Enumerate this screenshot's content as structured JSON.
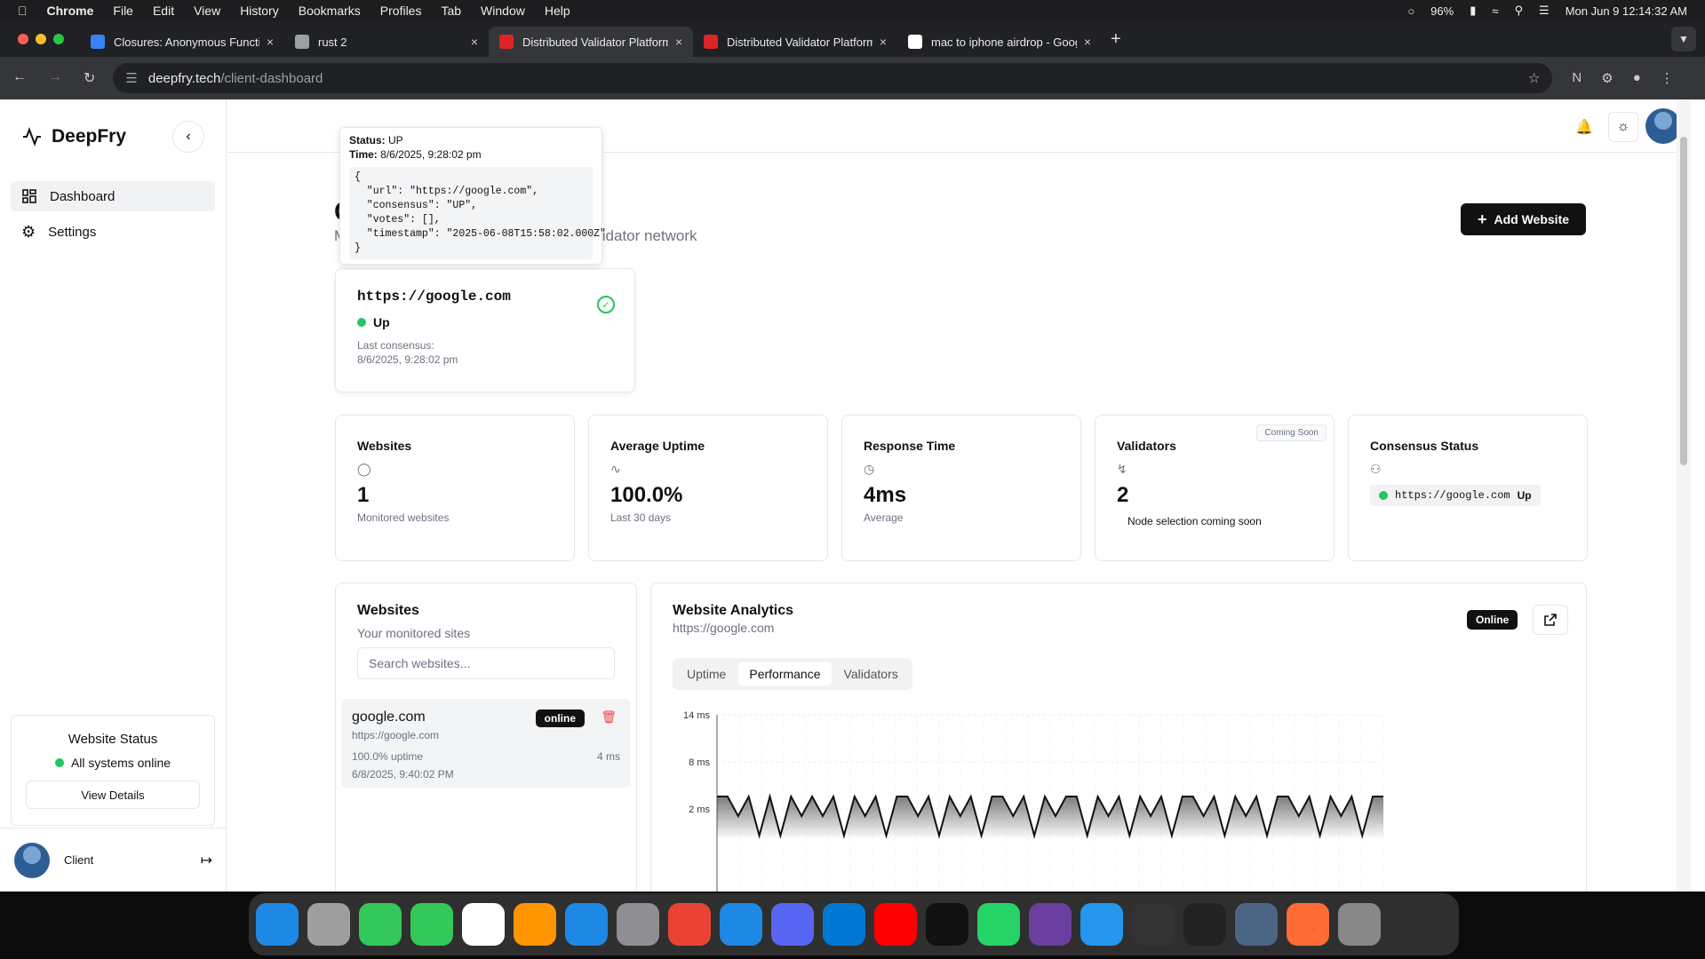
{
  "menubar": {
    "app": "Chrome",
    "items": [
      "File",
      "Edit",
      "View",
      "History",
      "Bookmarks",
      "Profiles",
      "Tab",
      "Window",
      "Help"
    ],
    "battery": "96%",
    "datetime": "Mon Jun 9  12:14:32 AM"
  },
  "tabs": [
    {
      "title": "Closures: Anonymous Functio",
      "favicon_color": "#3b82f6",
      "active": false
    },
    {
      "title": "rust 2",
      "favicon_color": "#9aa0a6",
      "active": false
    },
    {
      "title": "Distributed Validator Platform",
      "favicon_color": "#dc2626",
      "active": true
    },
    {
      "title": "Distributed Validator Platform",
      "favicon_color": "#dc2626",
      "active": false
    },
    {
      "title": "mac to iphone airdrop - Goog",
      "favicon_color": "#ffffff",
      "active": false
    }
  ],
  "address": {
    "host": "deepfry.tech",
    "path": "/client-dashboard"
  },
  "sidebar": {
    "brand": "DeepFry",
    "nav": [
      {
        "label": "Dashboard",
        "active": true
      },
      {
        "label": "Settings",
        "active": false
      }
    ],
    "status_title": "Website Status",
    "status_text": "All systems online",
    "status_button": "View Details",
    "user": "Client"
  },
  "header": {
    "title_fragment": "C",
    "subtitle_fragment_left": "M",
    "subtitle_fragment_right": "lidator network",
    "add_button": "Add Website"
  },
  "tooltip": {
    "status_label": "Status:",
    "status_value": "UP",
    "time_label": "Time:",
    "time_value": "8/6/2025, 9:28:02 pm",
    "json": "{\n  \"url\": \"https://google.com\",\n  \"consensus\": \"UP\",\n  \"votes\": [],\n  \"timestamp\": \"2025-06-08T15:58:02.000Z\"\n}"
  },
  "site_card": {
    "url": "https://google.com",
    "status": "Up",
    "last_label": "Last consensus:",
    "last_value": "8/6/2025, 9:28:02 pm"
  },
  "stats": [
    {
      "label": "Websites",
      "icon": "globe-icon",
      "value": "1",
      "caption": "Monitored websites"
    },
    {
      "label": "Average Uptime",
      "icon": "activity-icon",
      "value": "100.0%",
      "caption": "Last 30 days"
    },
    {
      "label": "Response Time",
      "icon": "clock-icon",
      "value": "4ms",
      "caption": "Average"
    },
    {
      "label": "Validators",
      "icon": "zap-icon",
      "value": "2",
      "caption": "Node selection coming soon",
      "badge": "Coming Soon"
    },
    {
      "label": "Consensus Status",
      "icon": "users-icon",
      "chip_url": "https://google.com",
      "chip_status": "Up"
    }
  ],
  "websites_panel": {
    "title": "Websites",
    "subtitle": "Your monitored sites",
    "search_placeholder": "Search websites...",
    "items": [
      {
        "name": "google.com",
        "url": "https://google.com",
        "status": "online",
        "uptime": "100.0% uptime",
        "response": "4 ms",
        "date": "6/8/2025, 9:40:02 PM"
      }
    ]
  },
  "analytics": {
    "title": "Website Analytics",
    "url": "https://google.com",
    "badge": "Online",
    "tabs": [
      {
        "label": "Uptime",
        "active": false
      },
      {
        "label": "Performance",
        "active": true
      },
      {
        "label": "Validators",
        "active": false
      }
    ]
  },
  "chart_data": {
    "type": "area",
    "y_ticks": [
      "14 ms",
      "8 ms",
      "2 ms"
    ],
    "ylim": [
      2,
      14
    ],
    "grid": true,
    "series": [
      {
        "values": [
          2,
          2,
          1,
          2,
          0,
          2,
          0,
          2,
          1,
          2,
          1,
          2,
          0,
          2,
          1,
          2,
          0,
          2,
          2,
          1,
          2,
          0,
          2,
          1,
          2,
          0,
          2,
          2,
          1,
          2,
          0,
          2,
          1,
          2,
          2,
          0,
          2,
          1,
          2,
          0,
          2,
          1,
          2,
          0,
          2,
          2,
          1,
          2,
          0,
          2,
          1,
          2,
          0,
          2,
          2,
          1,
          2,
          0,
          2,
          1,
          2,
          0,
          2,
          2
        ]
      }
    ]
  },
  "colors": {
    "accent": "#111111",
    "success": "#22c55e",
    "danger": "#ef4444",
    "muted": "#6b7280"
  }
}
